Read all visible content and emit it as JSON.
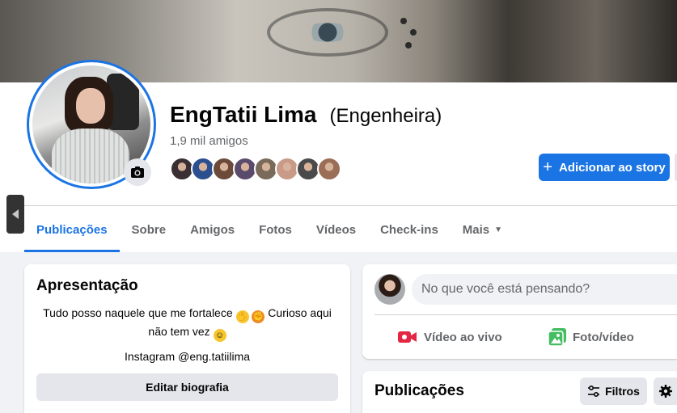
{
  "profile": {
    "name": "EngTatii Lima",
    "alternate_name": "(Engenheira)",
    "friends_count": "1,9 mil amigos",
    "friend_avatar_colors": [
      "#3a2f33",
      "#2c4f8f",
      "#6b4a3a",
      "#5a4a6b",
      "#7a6a5a",
      "#c99a88",
      "#4a4a4a",
      "#9b6e58"
    ]
  },
  "actions": {
    "add_story_label": "Adicionar ao story"
  },
  "tabs": [
    {
      "label": "Publicações",
      "active": true
    },
    {
      "label": "Sobre"
    },
    {
      "label": "Amigos"
    },
    {
      "label": "Fotos"
    },
    {
      "label": "Vídeos"
    },
    {
      "label": "Check-ins"
    },
    {
      "label": "Mais"
    }
  ],
  "intro": {
    "title": "Apresentação",
    "bio_part1": "Tudo posso naquele que me fortalece",
    "bio_part2": "Curioso aqui",
    "bio_part3": "não tem vez",
    "instagram": "Instagram @eng.tatiilima",
    "edit_bio_label": "Editar biografia"
  },
  "composer": {
    "placeholder": "No que você está pensando?",
    "live_label": "Vídeo ao vivo",
    "photo_label": "Foto/vídeo"
  },
  "posts": {
    "title": "Publicações",
    "filters_label": "Filtros"
  },
  "colors": {
    "accent": "#1b74e4",
    "live_red": "#e42645",
    "photo_green": "#45bd62"
  }
}
